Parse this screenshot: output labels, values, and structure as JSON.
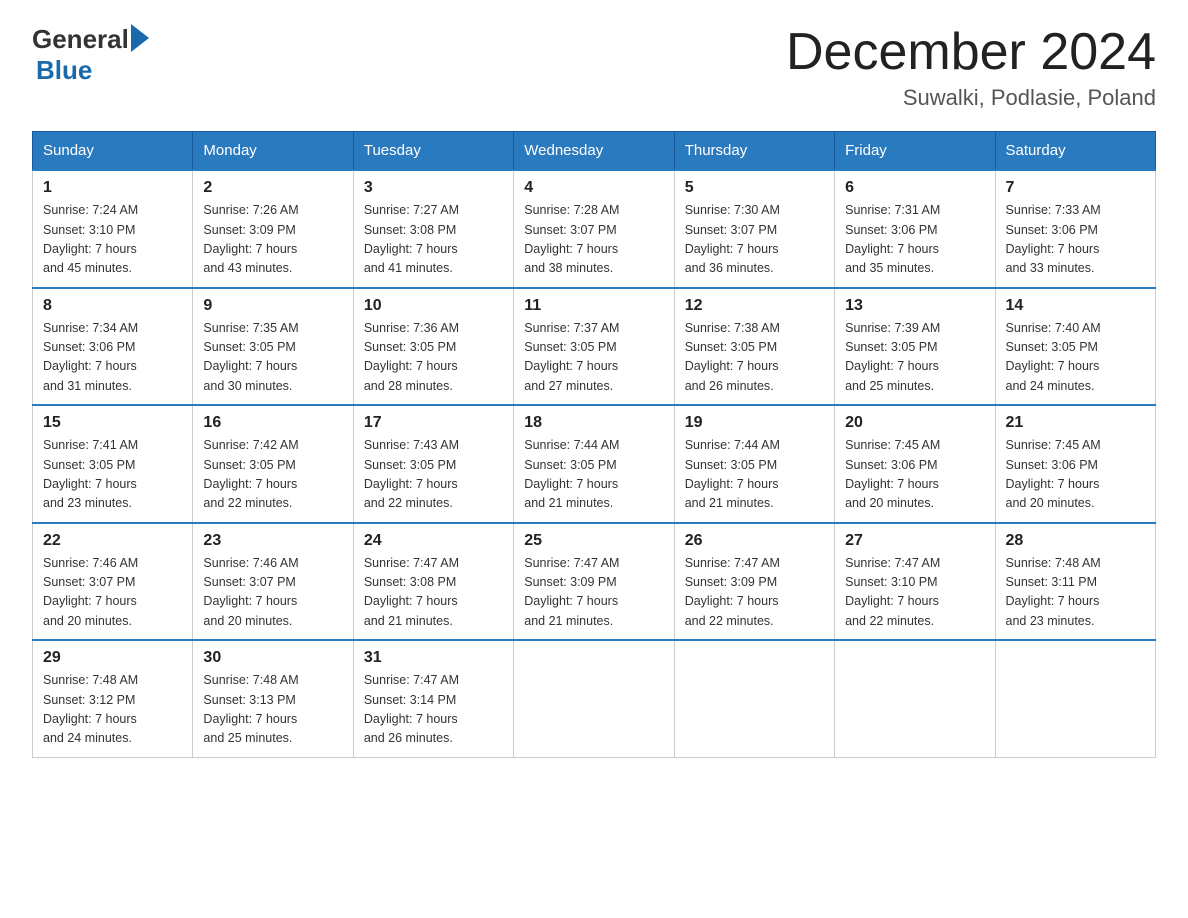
{
  "header": {
    "logo_general": "General",
    "logo_blue": "Blue",
    "month_year": "December 2024",
    "location": "Suwalki, Podlasie, Poland"
  },
  "days_of_week": [
    "Sunday",
    "Monday",
    "Tuesday",
    "Wednesday",
    "Thursday",
    "Friday",
    "Saturday"
  ],
  "weeks": [
    [
      {
        "day": "1",
        "sunrise": "7:24 AM",
        "sunset": "3:10 PM",
        "daylight": "7 hours and 45 minutes."
      },
      {
        "day": "2",
        "sunrise": "7:26 AM",
        "sunset": "3:09 PM",
        "daylight": "7 hours and 43 minutes."
      },
      {
        "day": "3",
        "sunrise": "7:27 AM",
        "sunset": "3:08 PM",
        "daylight": "7 hours and 41 minutes."
      },
      {
        "day": "4",
        "sunrise": "7:28 AM",
        "sunset": "3:07 PM",
        "daylight": "7 hours and 38 minutes."
      },
      {
        "day": "5",
        "sunrise": "7:30 AM",
        "sunset": "3:07 PM",
        "daylight": "7 hours and 36 minutes."
      },
      {
        "day": "6",
        "sunrise": "7:31 AM",
        "sunset": "3:06 PM",
        "daylight": "7 hours and 35 minutes."
      },
      {
        "day": "7",
        "sunrise": "7:33 AM",
        "sunset": "3:06 PM",
        "daylight": "7 hours and 33 minutes."
      }
    ],
    [
      {
        "day": "8",
        "sunrise": "7:34 AM",
        "sunset": "3:06 PM",
        "daylight": "7 hours and 31 minutes."
      },
      {
        "day": "9",
        "sunrise": "7:35 AM",
        "sunset": "3:05 PM",
        "daylight": "7 hours and 30 minutes."
      },
      {
        "day": "10",
        "sunrise": "7:36 AM",
        "sunset": "3:05 PM",
        "daylight": "7 hours and 28 minutes."
      },
      {
        "day": "11",
        "sunrise": "7:37 AM",
        "sunset": "3:05 PM",
        "daylight": "7 hours and 27 minutes."
      },
      {
        "day": "12",
        "sunrise": "7:38 AM",
        "sunset": "3:05 PM",
        "daylight": "7 hours and 26 minutes."
      },
      {
        "day": "13",
        "sunrise": "7:39 AM",
        "sunset": "3:05 PM",
        "daylight": "7 hours and 25 minutes."
      },
      {
        "day": "14",
        "sunrise": "7:40 AM",
        "sunset": "3:05 PM",
        "daylight": "7 hours and 24 minutes."
      }
    ],
    [
      {
        "day": "15",
        "sunrise": "7:41 AM",
        "sunset": "3:05 PM",
        "daylight": "7 hours and 23 minutes."
      },
      {
        "day": "16",
        "sunrise": "7:42 AM",
        "sunset": "3:05 PM",
        "daylight": "7 hours and 22 minutes."
      },
      {
        "day": "17",
        "sunrise": "7:43 AM",
        "sunset": "3:05 PM",
        "daylight": "7 hours and 22 minutes."
      },
      {
        "day": "18",
        "sunrise": "7:44 AM",
        "sunset": "3:05 PM",
        "daylight": "7 hours and 21 minutes."
      },
      {
        "day": "19",
        "sunrise": "7:44 AM",
        "sunset": "3:05 PM",
        "daylight": "7 hours and 21 minutes."
      },
      {
        "day": "20",
        "sunrise": "7:45 AM",
        "sunset": "3:06 PM",
        "daylight": "7 hours and 20 minutes."
      },
      {
        "day": "21",
        "sunrise": "7:45 AM",
        "sunset": "3:06 PM",
        "daylight": "7 hours and 20 minutes."
      }
    ],
    [
      {
        "day": "22",
        "sunrise": "7:46 AM",
        "sunset": "3:07 PM",
        "daylight": "7 hours and 20 minutes."
      },
      {
        "day": "23",
        "sunrise": "7:46 AM",
        "sunset": "3:07 PM",
        "daylight": "7 hours and 20 minutes."
      },
      {
        "day": "24",
        "sunrise": "7:47 AM",
        "sunset": "3:08 PM",
        "daylight": "7 hours and 21 minutes."
      },
      {
        "day": "25",
        "sunrise": "7:47 AM",
        "sunset": "3:09 PM",
        "daylight": "7 hours and 21 minutes."
      },
      {
        "day": "26",
        "sunrise": "7:47 AM",
        "sunset": "3:09 PM",
        "daylight": "7 hours and 22 minutes."
      },
      {
        "day": "27",
        "sunrise": "7:47 AM",
        "sunset": "3:10 PM",
        "daylight": "7 hours and 22 minutes."
      },
      {
        "day": "28",
        "sunrise": "7:48 AM",
        "sunset": "3:11 PM",
        "daylight": "7 hours and 23 minutes."
      }
    ],
    [
      {
        "day": "29",
        "sunrise": "7:48 AM",
        "sunset": "3:12 PM",
        "daylight": "7 hours and 24 minutes."
      },
      {
        "day": "30",
        "sunrise": "7:48 AM",
        "sunset": "3:13 PM",
        "daylight": "7 hours and 25 minutes."
      },
      {
        "day": "31",
        "sunrise": "7:47 AM",
        "sunset": "3:14 PM",
        "daylight": "7 hours and 26 minutes."
      },
      null,
      null,
      null,
      null
    ]
  ],
  "labels": {
    "sunrise": "Sunrise:",
    "sunset": "Sunset:",
    "daylight": "Daylight:"
  }
}
